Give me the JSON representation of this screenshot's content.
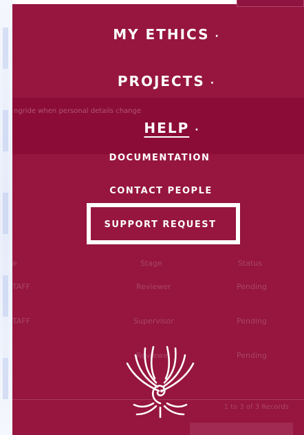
{
  "menu": {
    "main_items": [
      {
        "label": "MY ETHICS",
        "marker": "·"
      },
      {
        "label": "PROJECTS",
        "marker": "·"
      },
      {
        "label": "HELP",
        "marker": "·",
        "active": true
      }
    ],
    "help_submenu": [
      {
        "label": "DOCUMENTATION"
      },
      {
        "label": "CONTACT PEOPLE"
      },
      {
        "label": "SUPPORT REQUEST",
        "highlighted": true
      }
    ]
  },
  "background": {
    "notice": "ngride when personal details change",
    "table": {
      "headers": [
        "e",
        "Stage",
        "Status"
      ],
      "rows": [
        [
          "TAFF",
          "Reviewer",
          "Pending"
        ],
        [
          "TAFF",
          "Supervisor",
          "Pending"
        ],
        [
          "",
          "Reviewer",
          "Pending"
        ]
      ]
    },
    "pagination": "1 to 3 of 3 Records"
  },
  "colors": {
    "overlay": "#96163f",
    "band": "#8b0d37",
    "text": "#ffffff",
    "highlight_border": "#ffffff"
  },
  "icons": {
    "logo": "phoenix-logo"
  }
}
